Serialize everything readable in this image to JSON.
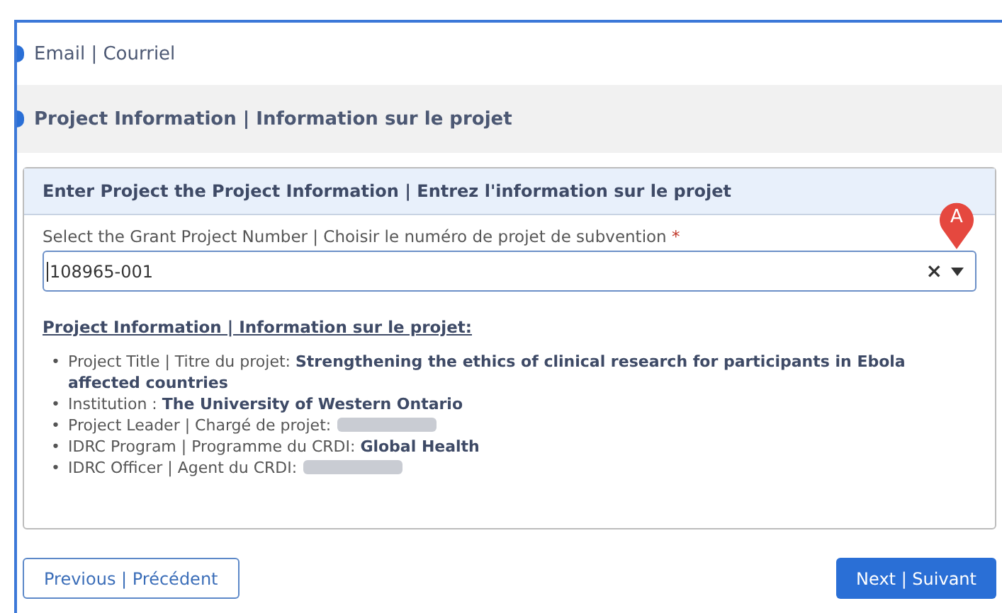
{
  "steps": [
    {
      "label": "Email | Courriel",
      "selected": false
    },
    {
      "label": "Project Information | Information sur le projet",
      "selected": true
    }
  ],
  "card": {
    "title": "Enter Project the Project Information | Entrez l'information sur le projet",
    "field": {
      "label": "Select the Grant Project Number | Choisir le numéro de projet de subvention",
      "required_mark": "*",
      "value": "108965-001",
      "clear": "×",
      "callout": "A"
    },
    "info_heading": "Project Information | Information sur le projet:",
    "bullet": "•",
    "items": [
      {
        "kind": "text",
        "label": "Project Title | Titre du projet:",
        "value": "Strengthening the ethics of clinical research for participants in Ebola affected countries"
      },
      {
        "kind": "text",
        "label": "Institution :",
        "value": "The University of Western Ontario"
      },
      {
        "kind": "redacted",
        "label": "Project Leader | Chargé de projet:"
      },
      {
        "kind": "text",
        "label": "IDRC Program | Programme du CRDI:",
        "value": "Global Health"
      },
      {
        "kind": "redacted",
        "label": "IDRC Officer | Agent du CRDI:"
      }
    ]
  },
  "buttons": {
    "previous": "Previous | Précédent",
    "next": "Next | Suivant"
  }
}
